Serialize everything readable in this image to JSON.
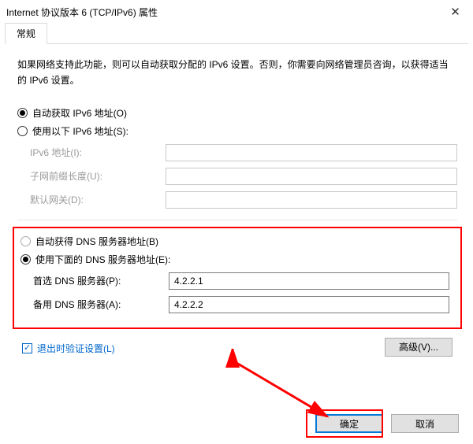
{
  "window": {
    "title": "Internet 协议版本 6 (TCP/IPv6) 属性",
    "close_glyph": "✕"
  },
  "tabs": {
    "general": "常规"
  },
  "desc": "如果网络支持此功能，则可以自动获取分配的 IPv6 设置。否则，你需要向网络管理员咨询，以获得适当的 IPv6 设置。",
  "ip": {
    "auto_label": "自动获取 IPv6 地址(O)",
    "manual_label": "使用以下 IPv6 地址(S):",
    "addr_label": "IPv6 地址(I):",
    "prefix_label": "子网前缀长度(U):",
    "gateway_label": "默认网关(D):"
  },
  "dns": {
    "auto_label": "自动获得 DNS 服务器地址(B)",
    "manual_label": "使用下面的 DNS 服务器地址(E):",
    "preferred_label": "首选 DNS 服务器(P):",
    "alternate_label": "备用 DNS 服务器(A):",
    "preferred_value": "4.2.2.1",
    "alternate_value": "4.2.2.2"
  },
  "validate_label": "退出时验证设置(L)",
  "buttons": {
    "advanced": "高级(V)...",
    "ok": "确定",
    "cancel": "取消"
  }
}
